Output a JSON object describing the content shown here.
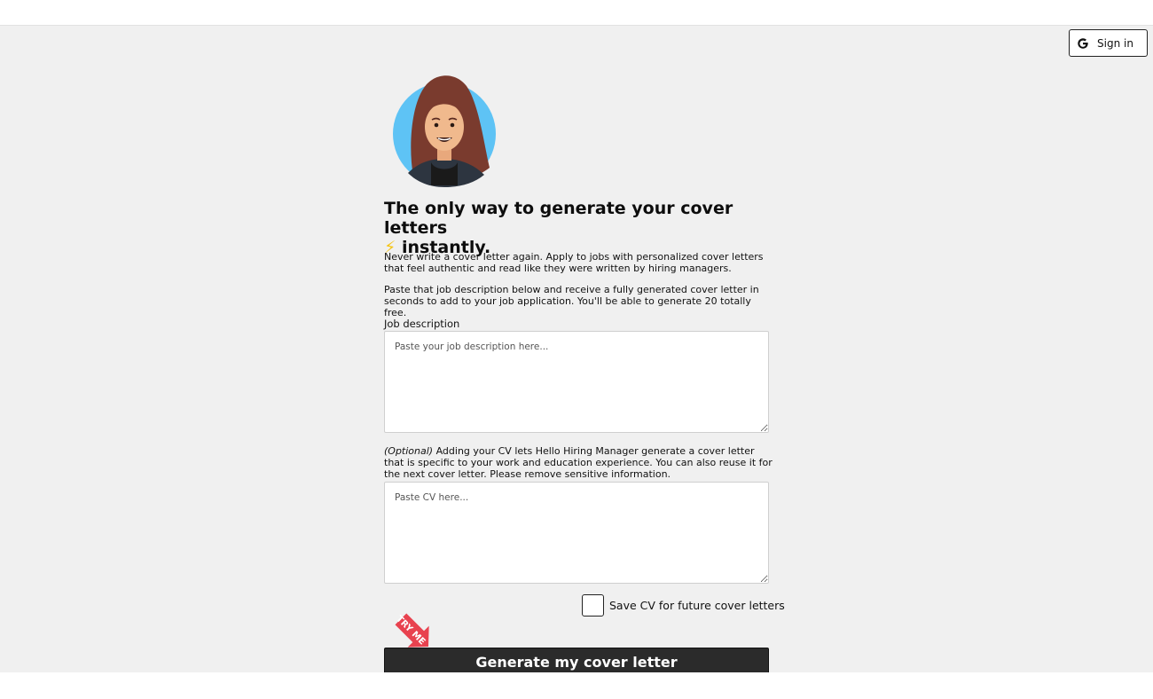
{
  "header": {
    "signin_label": "Sign in",
    "signin_icon": "google-icon"
  },
  "hero": {
    "avatar_icon": "avatar-woman-illustration",
    "headline_text": "The only way to generate your cover letters",
    "headline_emoji": "⚡",
    "headline_tail": "instantly.",
    "intro_1": "Never write a cover letter again. Apply to jobs with personalized cover letters that feel authentic and read like they were written by hiring managers.",
    "intro_2": "Paste that job description below and receive a fully generated cover letter in seconds to add to your job application. You'll be able to generate 20 totally free."
  },
  "form": {
    "job_label": "Job description",
    "job_placeholder": "Paste your job description here...",
    "cv_note_optional": "(Optional)",
    "cv_note": "Adding your CV lets Hello Hiring Manager generate a cover letter that is specific to your work and education experience. You can also reuse it for the next cover letter. Please remove sensitive information.",
    "cv_placeholder": "Paste CV here...",
    "save_label": "Save CV for future cover letters",
    "tryme_label": "TRY ME",
    "generate_label": "Generate my cover letter"
  },
  "colors": {
    "page_bg": "#f0f0f0",
    "button_bg": "#2b2b2b",
    "tryme_red": "#e8424f",
    "avatar_circle": "#5ec3f5"
  }
}
